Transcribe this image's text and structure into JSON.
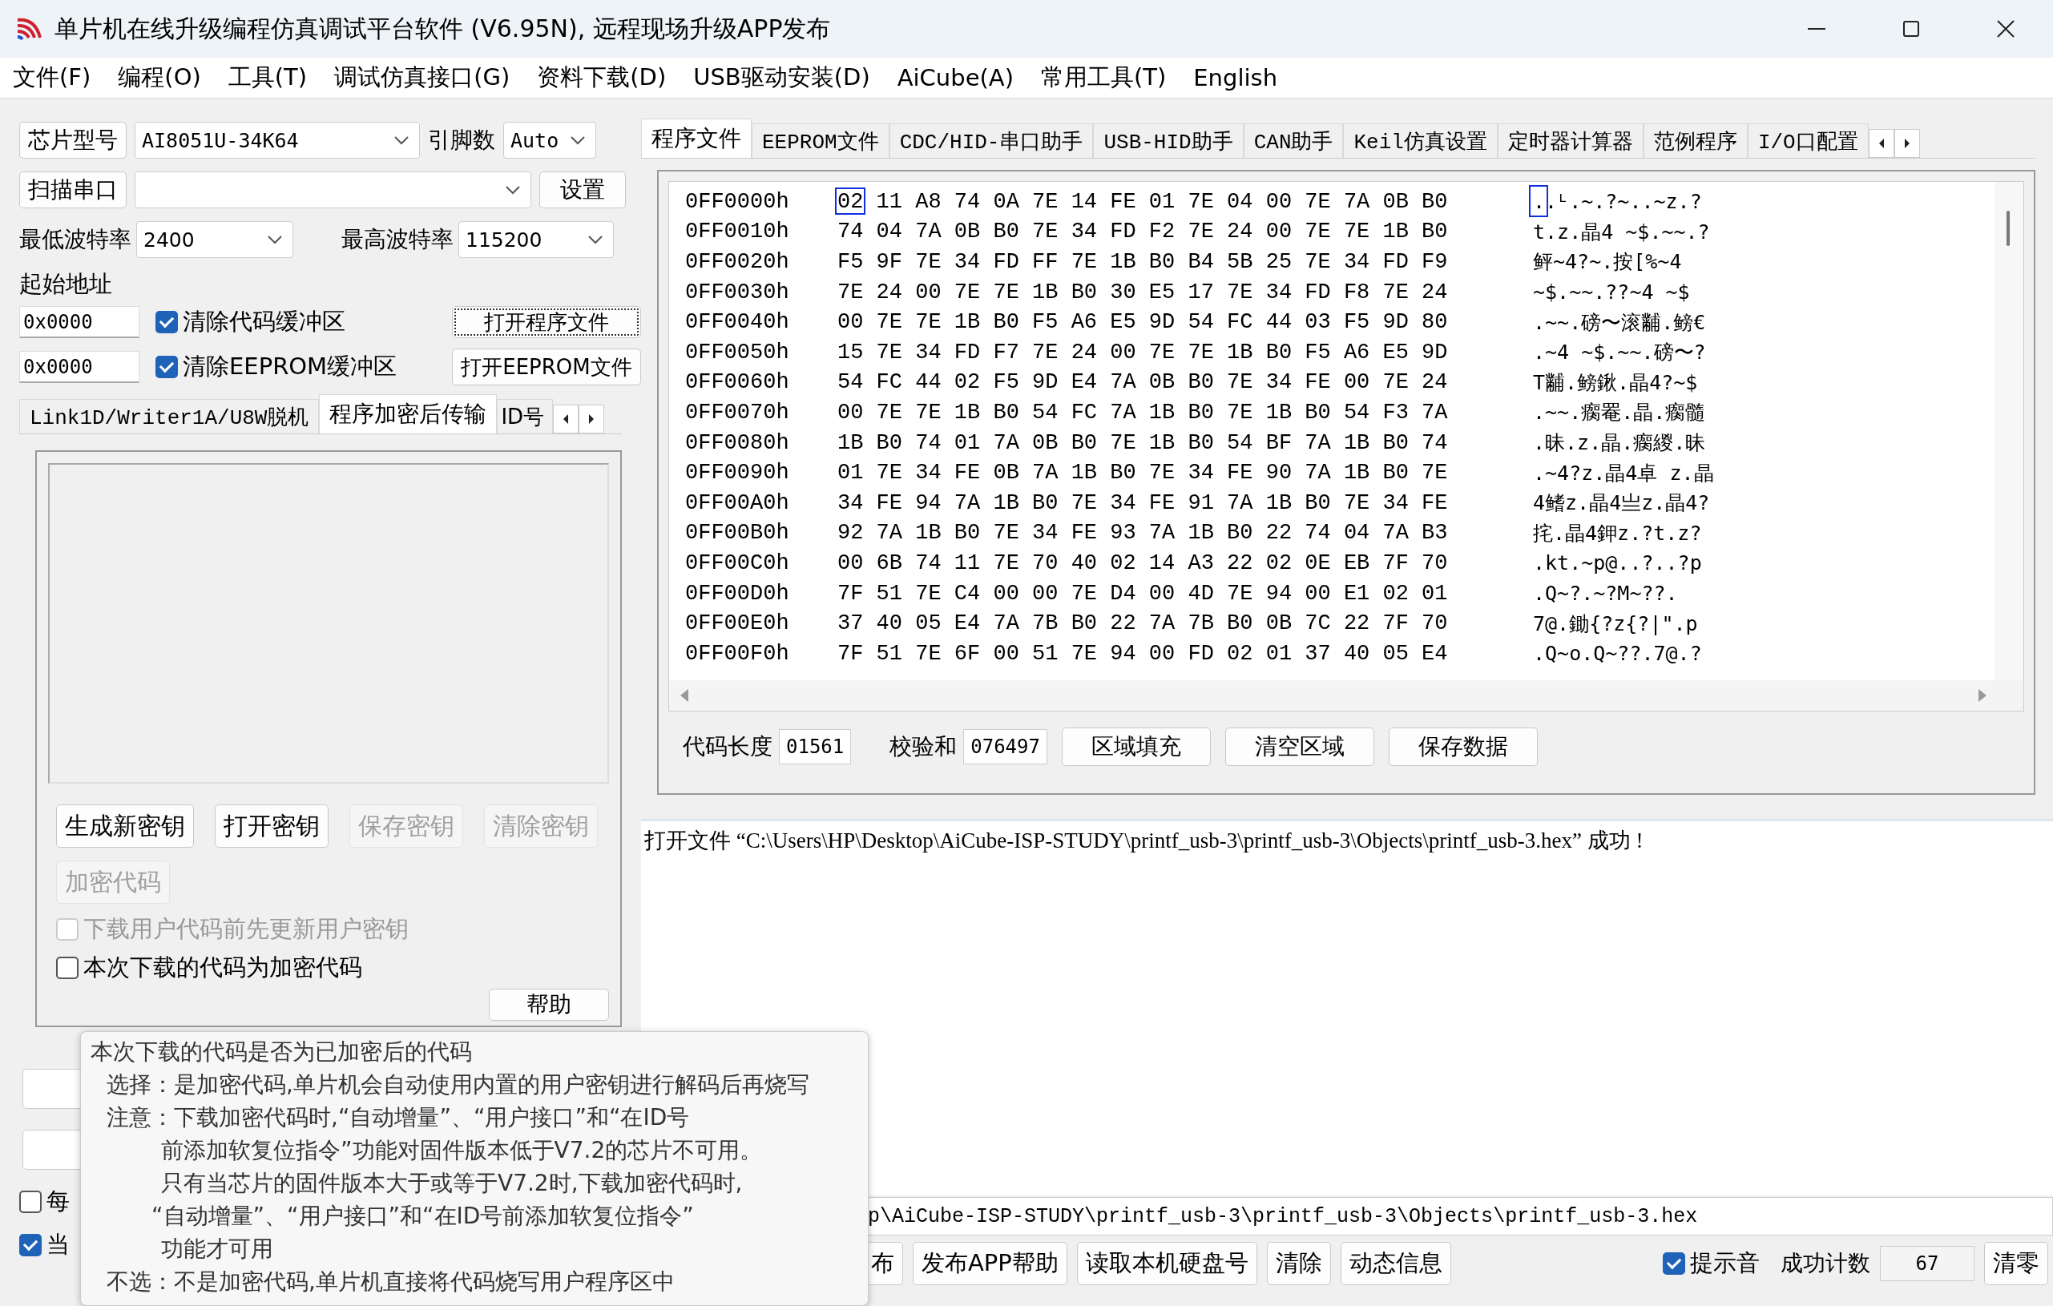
{
  "window": {
    "title": "单片机在线升级编程仿真调试平台软件 (V6.95N), 远程现场升级APP发布"
  },
  "menu": [
    "文件(F)",
    "编程(O)",
    "工具(T)",
    "调试仿真接口(G)",
    "资料下载(D)",
    "USB驱动安装(D)",
    "AiCube(A)",
    "常用工具(T)",
    "English"
  ],
  "chip": {
    "button": "芯片型号",
    "value": "AI8051U-34K64",
    "pins_label": "引脚数",
    "pins": "Auto"
  },
  "port": {
    "button": "扫描串口",
    "settings": "设置"
  },
  "baud": {
    "min_label": "最低波特率",
    "min": "2400",
    "max_label": "最高波特率",
    "max": "115200"
  },
  "start_address_label": "起始地址",
  "address_rows": [
    {
      "address": "0x0000",
      "label": "清除代码缓冲区",
      "checked": true,
      "button": "打开程序文件",
      "focused": true
    },
    {
      "address": "0x0000",
      "label": "清除EEPROM缓冲区",
      "checked": true,
      "button": "打开EEPROM文件",
      "focused": false
    }
  ],
  "left_tabs": [
    {
      "label": "Link1D/Writer1A/U8W脱机",
      "selected": false
    },
    {
      "label": "程序加密后传输",
      "selected": true
    },
    {
      "label": "ID号",
      "selected": false
    }
  ],
  "key_buttons": [
    {
      "label": "生成新密钥",
      "disabled": false
    },
    {
      "label": "打开密钥",
      "disabled": false
    },
    {
      "label": "保存密钥",
      "disabled": true
    },
    {
      "label": "清除密钥",
      "disabled": true
    },
    {
      "label": "加密代码",
      "disabled": true
    }
  ],
  "key_options": [
    {
      "label": "下载用户代码前先更新用户密钥",
      "checked": false,
      "disabled": true
    },
    {
      "label": "本次下载的代码为加密代码",
      "checked": false,
      "disabled": false
    }
  ],
  "help_button": "帮助",
  "lower_options": [
    {
      "label": "每",
      "checked": false
    },
    {
      "label": "当",
      "checked": true
    }
  ],
  "right_tabs": [
    {
      "label": "程序文件",
      "selected": true
    },
    {
      "label": "EEPROM文件",
      "selected": false
    },
    {
      "label": "CDC/HID-串口助手",
      "selected": false
    },
    {
      "label": "USB-HID助手",
      "selected": false
    },
    {
      "label": "CAN助手",
      "selected": false
    },
    {
      "label": "Keil仿真设置",
      "selected": false
    },
    {
      "label": "定时器计算器",
      "selected": false
    },
    {
      "label": "范例程序",
      "selected": false
    },
    {
      "label": "I/O口配置",
      "selected": false
    }
  ],
  "hex_rows": [
    {
      "address": "0FF0000h",
      "bytes": "02 11 A8 74 0A 7E 14 FE 01 7E 04 00 7E 7A 0B B0",
      "text": "..ᴸ.~.?~..~z.?",
      "cursor": true
    },
    {
      "address": "0FF0010h",
      "bytes": "74 04 7A 0B B0 7E 34 FD F2 7E 24 00 7E 7E 1B B0",
      "text": "t.z.晶4  ~$.~~.?",
      "cursor": false
    },
    {
      "address": "0FF0020h",
      "bytes": "F5 9F 7E 34 FD FF 7E 1B B0 B4 5B 25 7E 34 FD F9",
      "text": "鲆~4?~.按[%~4",
      "cursor": false
    },
    {
      "address": "0FF0030h",
      "bytes": "7E 24 00 7E 7E 1B B0 30 E5 17 7E 34 FD F8 7E 24",
      "text": "~$.~~.??~4  ~$",
      "cursor": false
    },
    {
      "address": "0FF0040h",
      "bytes": "00 7E 7E 1B B0 F5 A6 E5 9D 54 FC 44 03 F5 9D 80",
      "text": ".~~.磅〜滚黼.鳑€",
      "cursor": false
    },
    {
      "address": "0FF0050h",
      "bytes": "15 7E 34 FD F7 7E 24 00 7E 7E 1B B0 F5 A6 E5 9D",
      "text": ".~4  ~$.~~.磅〜?",
      "cursor": false
    },
    {
      "address": "0FF0060h",
      "bytes": "54 FC 44 02 F5 9D E4 7A 0B B0 7E 34 FE 00 7E 24",
      "text": "T黼.鳑鍬.晶4?~$",
      "cursor": false
    },
    {
      "address": "0FF0070h",
      "bytes": "00 7E 7E 1B B0 54 FC 7A 1B B0 7E 1B B0 54 F3 7A",
      "text": ".~~.瘸罨.晶.瘸髓",
      "cursor": false
    },
    {
      "address": "0FF0080h",
      "bytes": "1B B0 74 01 7A 0B B0 7E 1B B0 54 BF 7A 1B B0 74",
      "text": ".昧.z.晶.瘸緵.昧",
      "cursor": false
    },
    {
      "address": "0FF0090h",
      "bytes": "01 7E 34 FE 0B 7A 1B B0 7E 34 FE 90 7A 1B B0 7E",
      "text": ".~4?z.晶4卓 z.晶",
      "cursor": false
    },
    {
      "address": "0FF00A0h",
      "bytes": "34 FE 94 7A 1B B0 7E 34 FE 91 7A 1B B0 7E 34 FE",
      "text": "4鳍z.晶4亗z.晶4?",
      "cursor": false
    },
    {
      "address": "0FF00B0h",
      "bytes": "92 7A 1B B0 7E 34 FE 93 7A 1B B0 22 74 04 7A B3",
      "text": "挓.晶4鉀z.?t.z?",
      "cursor": false
    },
    {
      "address": "0FF00C0h",
      "bytes": "00 6B 74 11 7E 70 40 02 14 A3 22 02 0E EB 7F 70",
      "text": ".kt.~p@..?..?p",
      "cursor": false
    },
    {
      "address": "0FF00D0h",
      "bytes": "7F 51 7E C4 00 00 7E D4 00 4D 7E 94 00 E1 02 01",
      "text": ".Q~?.~?M~??.",
      "cursor": false
    },
    {
      "address": "0FF00E0h",
      "bytes": "37 40 05 E4 7A 7B B0 22 7A 7B B0 0B 7C 22 7F 70",
      "text": "7@.鋤{?z{?|\".p",
      "cursor": false
    },
    {
      "address": "0FF00F0h",
      "bytes": "7F 51 7E 6F 00 51 7E 94 00 FD 02 01 37 40 05 E4",
      "text": ".Q~o.Q~??.7@.?",
      "cursor": false
    }
  ],
  "hex_footer": {
    "length_label": "代码长度",
    "length": "01561",
    "checksum_label": "校验和",
    "checksum": "076497",
    "buttons": [
      "区域填充",
      "清空区域",
      "保存数据"
    ]
  },
  "log": [
    "打开文件 “C:\\Users\\HP\\Desktop\\AiCube-ISP-STUDY\\printf_usb-3\\printf_usb-3\\Objects\\printf_usb-3.hex” 成功 !"
  ],
  "path": "p\\AiCube-ISP-STUDY\\printf_usb-3\\printf_usb-3\\Objects\\printf_usb-3.hex",
  "bottom_buttons": [
    "布",
    "发布APP帮助",
    "读取本机硬盘号",
    "清除",
    "动态信息"
  ],
  "beep": {
    "label": "提示音",
    "checked": true
  },
  "count": {
    "label": "成功计数",
    "value": "67",
    "reset": "清零"
  },
  "tooltip": {
    "lines": [
      {
        "kind": "heading",
        "text": "本次下载的代码是否为已加密后的代码"
      },
      {
        "kind": "item",
        "text": "选择：是加密代码,单片机会自动使用内置的用户密钥进行解码后再烧写"
      },
      {
        "kind": "item",
        "text": "注意：下载加密代码时,“自动增量”、“用户接口”和“在ID号"
      },
      {
        "kind": "continuation",
        "text": "前添加软复位指令”功能对固件版本低于V7.2的芯片不可用。"
      },
      {
        "kind": "continuation",
        "text": "只有当芯片的固件版本大于或等于V7.2时,下载加密代码时,"
      },
      {
        "kind": "hanging",
        "text": "“自动增量”、“用户接口”和“在ID号前添加软复位指令”"
      },
      {
        "kind": "continuation",
        "text": "功能才可用"
      },
      {
        "kind": "item",
        "text": "不选：不是加密代码,单片机直接将代码烧写用户程序区中"
      }
    ]
  }
}
